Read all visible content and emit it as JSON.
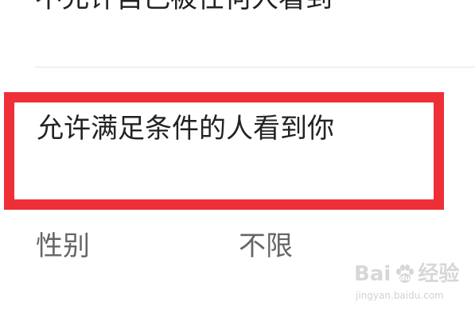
{
  "options": {
    "hide_from_all": "不允许自己被任何人看到",
    "allow_matching": "允许满足条件的人看到你"
  },
  "filters": {
    "gender_label": "性别",
    "gender_value": "不限"
  },
  "highlight": {
    "color": "#ee2f37"
  },
  "watermark": {
    "text_left": "Bai",
    "text_right": "经验",
    "url": "jingyan.baidu.com",
    "icon": "paw-icon"
  }
}
